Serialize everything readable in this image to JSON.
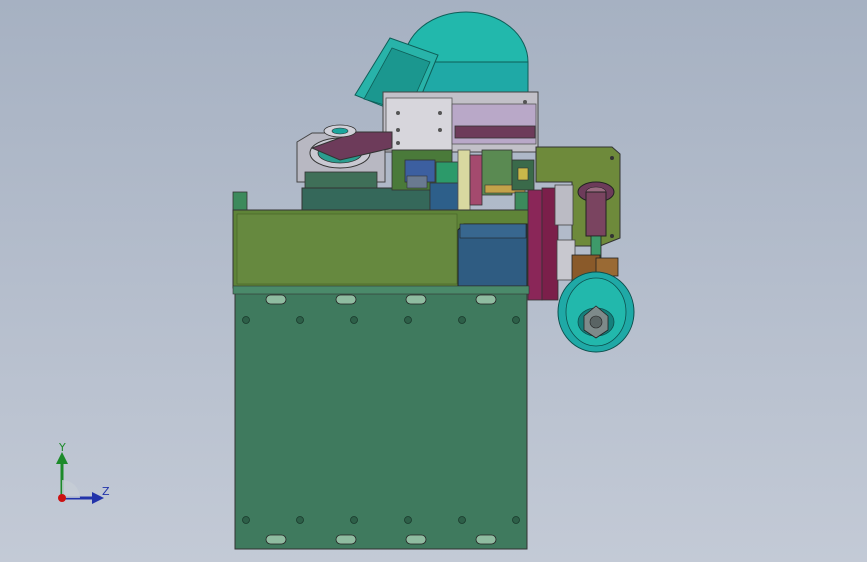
{
  "viewport": {
    "background_top": "#a6b1c2",
    "background_bottom": "#c3cad6"
  },
  "model": {
    "colors": {
      "base_plate": "#3f7a5e",
      "top_housing": "#5f8438",
      "motor": "#22b8ac",
      "motor_dark": "#178f86",
      "bracket": "#c9c9d2",
      "arm": "#6d3b5a",
      "side_plate": "#6e8a3b",
      "roller": "#1fa9a6",
      "blue_block": "#2f5c82",
      "maroon": "#7b1f4a",
      "brown": "#8a5a2a",
      "gray": "#7e8a8a"
    }
  },
  "triad": {
    "y_label": "Y",
    "z_label": "Z",
    "y_color": "#1c8a2a",
    "z_color": "#2233aa",
    "origin_color": "#cc1111"
  }
}
